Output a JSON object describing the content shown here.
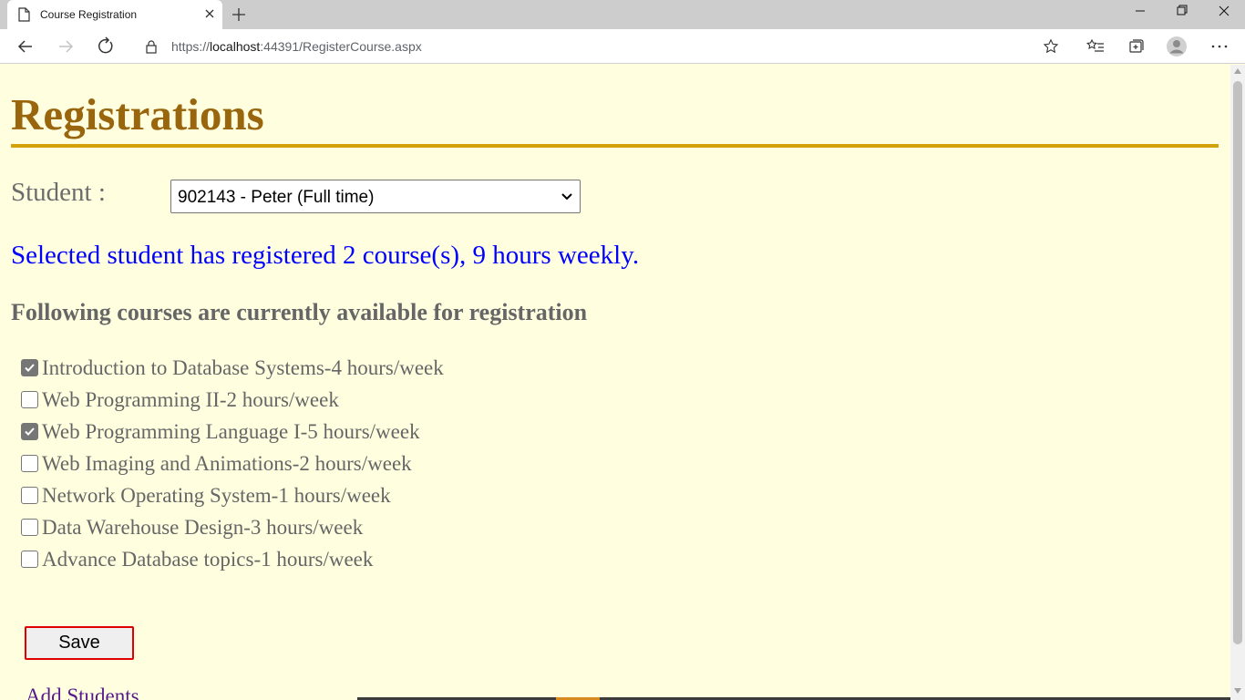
{
  "browser": {
    "tab_title": "Course Registration",
    "url_prefix": "https://",
    "url_host": "localhost",
    "url_rest": ":44391/RegisterCourse.aspx"
  },
  "page": {
    "heading": "Registrations",
    "student_label": "Student :",
    "student_selected": "902143 - Peter (Full time)",
    "summary": "Selected student has registered 2 course(s), 9 hours weekly.",
    "courses_heading": "Following courses are currently available for registration",
    "courses": [
      {
        "label": "Introduction to Database Systems-4 hours/week",
        "checked": true
      },
      {
        "label": "Web Programming II-2 hours/week",
        "checked": false
      },
      {
        "label": "Web Programming Language I-5 hours/week",
        "checked": true
      },
      {
        "label": "Web Imaging and Animations-2 hours/week",
        "checked": false
      },
      {
        "label": "Network Operating System-1 hours/week",
        "checked": false
      },
      {
        "label": "Data Warehouse Design-3 hours/week",
        "checked": false
      },
      {
        "label": "Advance Database topics-1 hours/week",
        "checked": false
      }
    ],
    "save_label": "Save",
    "add_students_label": "Add Students"
  },
  "colors": {
    "page_background": "#ffffe0",
    "heading": "#99660d",
    "rule": "#d3a20a",
    "summary": "#0000ff",
    "save_border": "#e00000"
  }
}
